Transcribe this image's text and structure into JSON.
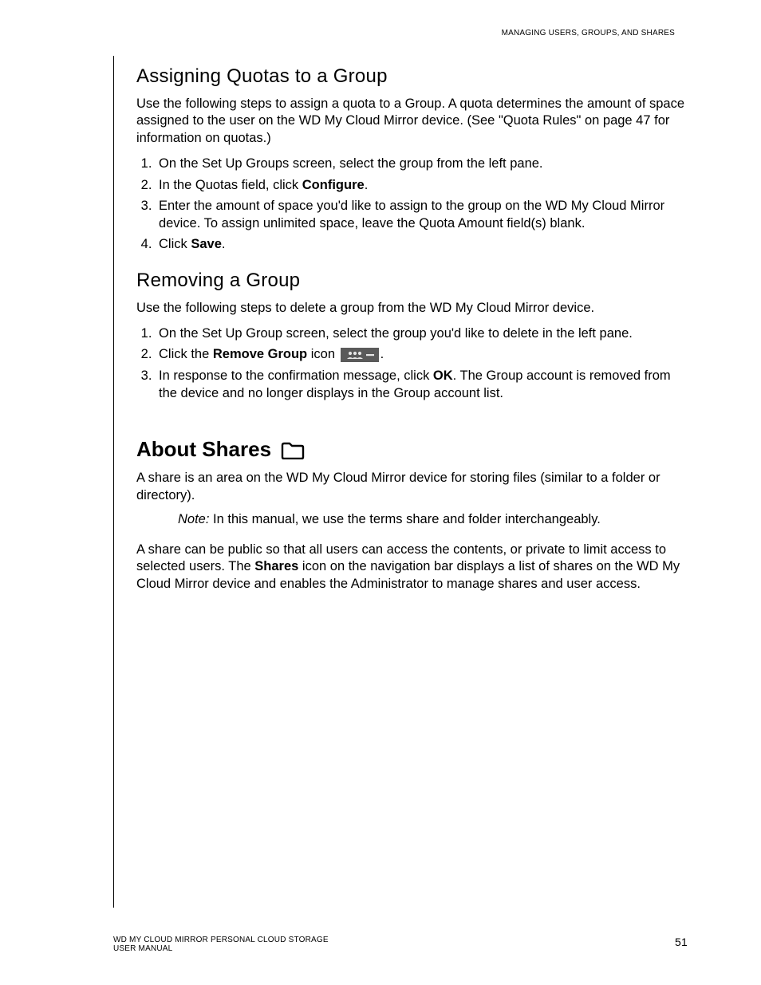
{
  "running_header": "MANAGING USERS, GROUPS, AND SHARES",
  "section1": {
    "heading": "Assigning Quotas to a Group",
    "intro": "Use the following steps to assign a quota to a Group. A quota determines the amount of space assigned to the user on the WD My Cloud Mirror device. (See \"Quota Rules\" on page 47 for information on quotas.)",
    "steps": {
      "s1": "On the Set Up Groups screen, select the group from the left pane.",
      "s2_pre": "In the Quotas field, click ",
      "s2_bold": "Configure",
      "s2_post": ".",
      "s3": "Enter the amount of space you'd like to assign to the group on the WD My Cloud Mirror device. To assign unlimited space, leave the Quota Amount field(s) blank.",
      "s4_pre": "Click ",
      "s4_bold": "Save",
      "s4_post": "."
    }
  },
  "section2": {
    "heading": "Removing a Group",
    "intro": "Use the following steps to delete a group from the WD My Cloud Mirror device.",
    "steps": {
      "s1": "On the Set Up Group screen, select the group you'd like to delete in the left pane.",
      "s2_pre": "Click the ",
      "s2_bold": "Remove Group",
      "s2_mid": " icon ",
      "s2_post": ".",
      "s3_pre": "In response to the confirmation message, click ",
      "s3_bold": "OK",
      "s3_post": ". The Group account is removed from the device and no longer displays in the Group account list."
    }
  },
  "section3": {
    "heading": "About Shares",
    "intro": "A share is an area on the WD My Cloud Mirror device for storing files (similar to a folder or directory).",
    "note_label": "Note:",
    "note_text": "  In this manual, we use the terms share and folder interchangeably.",
    "para2_pre": "A share can be public so that all users can access the contents, or private to limit access to selected users. The ",
    "para2_bold": "Shares",
    "para2_post": " icon on the navigation bar displays a list of shares on the WD My Cloud Mirror device and enables the Administrator to manage shares and user access."
  },
  "footer": {
    "line1": "WD MY CLOUD MIRROR PERSONAL CLOUD STORAGE",
    "line2": "USER MANUAL",
    "page": "51"
  }
}
